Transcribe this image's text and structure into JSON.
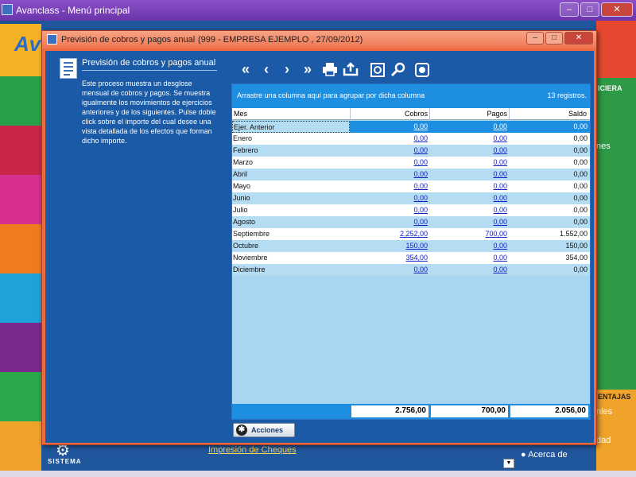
{
  "main_window": {
    "title": "Avanclass - Menú principal",
    "logo_text": "Av",
    "sistema_label": "SISTEMA",
    "impresion_link": "Impresión de Cheques",
    "acerca_label": "Acerca de",
    "right_labels": [
      "ICIERA",
      "nes",
      "ENTAJAS",
      "nles",
      "dad"
    ],
    "colors": {
      "tiles": [
        "#f4b326",
        "#27a24a",
        "#c9264a",
        "#d7308f",
        "#f07a1f",
        "#1ea3d9",
        "#7a2a8c",
        "#2aa84a",
        "#f0a32a"
      ]
    }
  },
  "dialog": {
    "title": "Previsión de cobros y pagos anual",
    "subtitle": "(999 - EMPRESA EJEMPLO , 27/09/2012)",
    "info_title": "Previsión de cobros y pagos anual",
    "info_text": "Este proceso muestra un desglose mensual de cobros y pagos. Se muestra igualmente los movimientos de ejercicios anteriores y de los siguientes. Pulse doble click sobre el importe del cual desee una vista detallada de los efectos que forman dicho importe.",
    "toolbar": [
      "first-icon",
      "prev-icon",
      "next-icon",
      "last-icon",
      "print-icon",
      "export-icon",
      "grid-settings-icon",
      "zoom-icon",
      "settings-icon"
    ],
    "group_hint": "Arrastre una columna aquí para agrupar por dicha columna",
    "record_count": "13 registros.",
    "columns": {
      "mes": "Mes",
      "cobros": "Cobros",
      "pagos": "Pagos",
      "saldo": "Saldo"
    },
    "rows": [
      {
        "mes": "Ejer. Anterior",
        "cobros": "0,00",
        "pagos": "0,00",
        "saldo": "0,00"
      },
      {
        "mes": "Enero",
        "cobros": "0,00",
        "pagos": "0,00",
        "saldo": "0,00"
      },
      {
        "mes": "Febrero",
        "cobros": "0,00",
        "pagos": "0,00",
        "saldo": "0,00"
      },
      {
        "mes": "Marzo",
        "cobros": "0,00",
        "pagos": "0,00",
        "saldo": "0,00"
      },
      {
        "mes": "Abril",
        "cobros": "0,00",
        "pagos": "0,00",
        "saldo": "0,00"
      },
      {
        "mes": "Mayo",
        "cobros": "0,00",
        "pagos": "0,00",
        "saldo": "0,00"
      },
      {
        "mes": "Junio",
        "cobros": "0,00",
        "pagos": "0,00",
        "saldo": "0,00"
      },
      {
        "mes": "Julio",
        "cobros": "0,00",
        "pagos": "0,00",
        "saldo": "0,00"
      },
      {
        "mes": "Agosto",
        "cobros": "0,00",
        "pagos": "0,00",
        "saldo": "0,00"
      },
      {
        "mes": "Septiembre",
        "cobros": "2.252,00",
        "pagos": "700,00",
        "saldo": "1.552,00"
      },
      {
        "mes": "Octubre",
        "cobros": "150,00",
        "pagos": "0,00",
        "saldo": "150,00"
      },
      {
        "mes": "Noviembre",
        "cobros": "354,00",
        "pagos": "0,00",
        "saldo": "354,00"
      },
      {
        "mes": "Diciembre",
        "cobros": "0,00",
        "pagos": "0,00",
        "saldo": "0,00"
      }
    ],
    "totals": {
      "cobros": "2.756,00",
      "pagos": "700,00",
      "saldo": "2.056,00"
    },
    "acciones_label": "Acciones"
  }
}
